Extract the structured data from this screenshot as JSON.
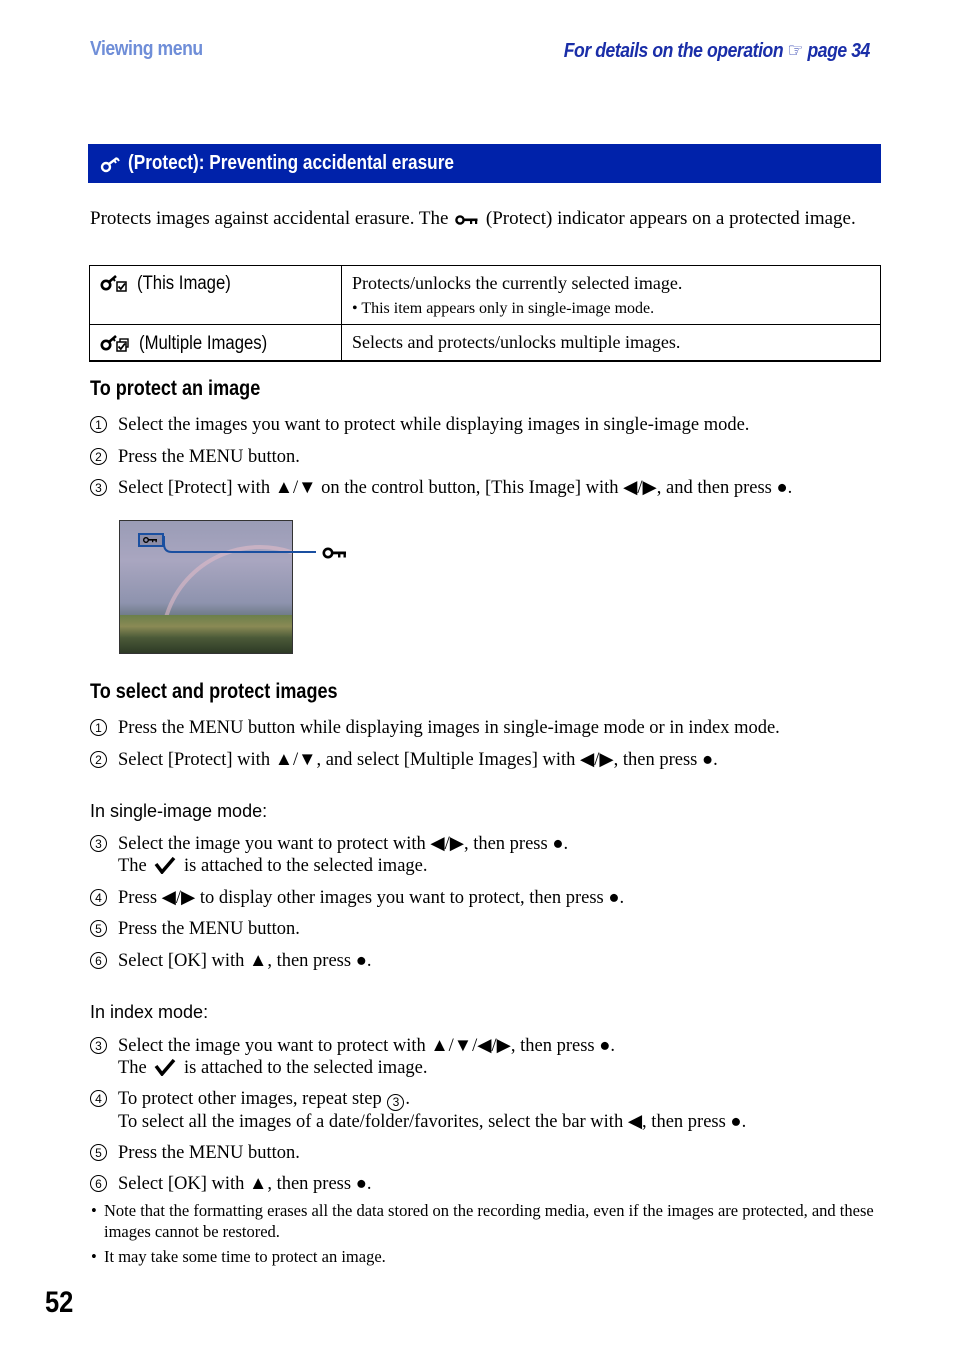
{
  "header": {
    "section": "Viewing menu",
    "ref_prefix": "For details on the operation",
    "ref_icon": "pointing-hand-icon",
    "ref_page": "page 34"
  },
  "banner": {
    "icon": "protect-key-icon",
    "title": "(Protect): Preventing accidental erasure"
  },
  "intro": {
    "before_icon": "Protects images against accidental erasure. The",
    "icon": "protect-indicator-icon",
    "after_icon": "(Protect) indicator appears on a protected image."
  },
  "options": [
    {
      "icon": "protect-this-image-icon",
      "label": "(This Image)",
      "description": "Protects/unlocks the currently selected image.",
      "note": "This item appears only in single-image mode."
    },
    {
      "icon": "protect-multiple-images-icon",
      "label": "(Multiple Images)",
      "description": "Selects and protects/unlocks multiple images."
    }
  ],
  "section1": {
    "title": "To protect an image",
    "steps": [
      {
        "num": "1",
        "text": "Select the images you want to protect while displaying images in single-image mode."
      },
      {
        "num": "2",
        "text": "Press the MENU button."
      },
      {
        "num": "3",
        "text": "Select [Protect] with ▲/▼ on the control button, [This Image] with ◀/▶, and then press ●."
      }
    ],
    "figure": {
      "callout_icon": "protect-indicator-icon",
      "description": "Rainbow landscape photo with protect indicator"
    }
  },
  "section2": {
    "title": "To select and protect images",
    "steps": [
      {
        "num": "1",
        "text": "Press the MENU button while displaying images in single-image mode or in index mode."
      },
      {
        "num": "2",
        "text": "Select [Protect] with ▲/▼, and select [Multiple Images] with ◀/▶, then press ●."
      }
    ],
    "single_mode": {
      "title": "In single-image mode:",
      "steps": [
        {
          "num": "3",
          "text": "Select the image you want to protect with ◀/▶, then press ●.",
          "line2_before": "The",
          "line2_after": "is attached to the selected image."
        },
        {
          "num": "4",
          "text": "Press ◀/▶ to display other images you want to protect, then press ●."
        },
        {
          "num": "5",
          "text": "Press the MENU button."
        },
        {
          "num": "6",
          "text": "Select [OK] with ▲, then press ●."
        }
      ]
    },
    "index_mode": {
      "title": "In index mode:",
      "steps": [
        {
          "num": "3",
          "text": "Select the image you want to protect with ▲/▼/◀/▶, then press ●.",
          "line2_before": "The",
          "line2_after": "is attached to the selected image."
        },
        {
          "num": "4",
          "text": "To protect other images, repeat step",
          "ref_num": "3",
          "text_end": ".",
          "line2": "To select all the images of a date/folder/favorites, select the bar with ◀, then press ●."
        },
        {
          "num": "5",
          "text": "Press the MENU button."
        },
        {
          "num": "6",
          "text": "Select [OK] with ▲, then press ●."
        }
      ]
    },
    "notes": [
      "Note that the formatting erases all the data stored on the recording media, even if the images are protected, and these images cannot be restored.",
      "It may take some time to protect an image."
    ]
  },
  "page_number": "52",
  "colors": {
    "banner_bg": "#0022aa",
    "header_left": "#6f8ed8",
    "header_right": "#1a2ea8"
  }
}
